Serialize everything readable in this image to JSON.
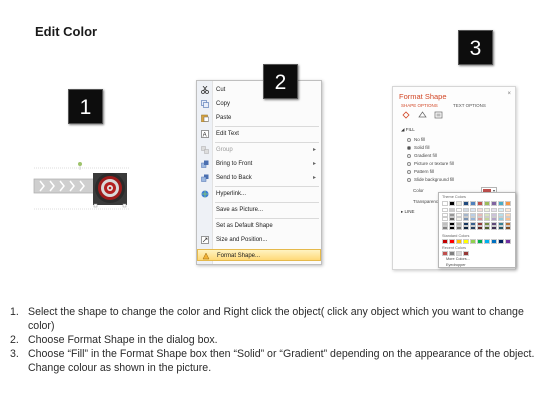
{
  "title": "Edit Color",
  "badges": {
    "step1": "1",
    "step2": "2",
    "step3": "3"
  },
  "context_menu": {
    "items": [
      {
        "label": "Cut",
        "icon": "scissors-icon",
        "disabled": false,
        "submenu": false
      },
      {
        "label": "Copy",
        "icon": "copy-icon",
        "disabled": false,
        "submenu": false
      },
      {
        "label": "Paste",
        "icon": "paste-icon",
        "disabled": false,
        "submenu": false
      },
      {
        "label": "Edit Text",
        "icon": "edit-text-icon",
        "disabled": false,
        "submenu": false
      },
      {
        "label": "Group",
        "icon": "group-icon",
        "disabled": true,
        "submenu": true
      },
      {
        "label": "Bring to Front",
        "icon": "bring-front-icon",
        "disabled": false,
        "submenu": true
      },
      {
        "label": "Send to Back",
        "icon": "send-back-icon",
        "disabled": false,
        "submenu": true
      },
      {
        "label": "Hyperlink...",
        "icon": "hyperlink-icon",
        "disabled": false,
        "submenu": false
      },
      {
        "label": "Save as Picture...",
        "icon": "",
        "disabled": false,
        "submenu": false
      },
      {
        "label": "Set as Default Shape",
        "icon": "",
        "disabled": false,
        "submenu": false
      },
      {
        "label": "Size and Position...",
        "icon": "size-icon",
        "disabled": false,
        "submenu": false
      },
      {
        "label": "Format Shape...",
        "icon": "format-shape-icon",
        "disabled": false,
        "submenu": false,
        "highlighted": true
      }
    ]
  },
  "format_pane": {
    "title": "Format Shape",
    "close": "×",
    "tabs": {
      "shape_options": "SHAPE OPTIONS",
      "text_options": "TEXT OPTIONS"
    },
    "fill_section": "◢  FILL",
    "fill_options": [
      "No fill",
      "Solid fill",
      "Gradient fill",
      "Picture or texture fill",
      "Pattern fill",
      "Slide background fill"
    ],
    "selected_fill": "Solid fill",
    "color_label": "Color",
    "transparency_label": "Transparency",
    "line_section": "▸  LINE",
    "selected_color": "#c0504d"
  },
  "palette": {
    "theme_colors_label": "Theme Colors",
    "standard_colors_label": "Standard Colors",
    "recent_colors_label": "Recent Colors",
    "more_colors": "More Colors...",
    "eyedropper": "Eyedropper",
    "theme_top": [
      "#ffffff",
      "#000000",
      "#eeece1",
      "#1f497d",
      "#4f81bd",
      "#c0504d",
      "#9bbb59",
      "#8064a2",
      "#4bacc6",
      "#f79646"
    ],
    "standard": [
      "#c00000",
      "#ff0000",
      "#ffc000",
      "#ffff00",
      "#92d050",
      "#00b050",
      "#00b0f0",
      "#0070c0",
      "#002060",
      "#7030a0"
    ],
    "recent": [
      "#c0504d",
      "#7f7f7f",
      "#d9d9d9",
      "#953735"
    ]
  },
  "instructions": [
    {
      "num": "1.",
      "text": "Select the shape to change the color and Right click the object( click any object which you want to change color)"
    },
    {
      "num": "2.",
      "text": "Choose Format Shape in the dialog box."
    },
    {
      "num": "3.",
      "text": "Choose “Fill” in the Format Shape box then “Solid” or “Gradient” depending on the appearance of the object. Change colour as shown in the picture."
    }
  ]
}
